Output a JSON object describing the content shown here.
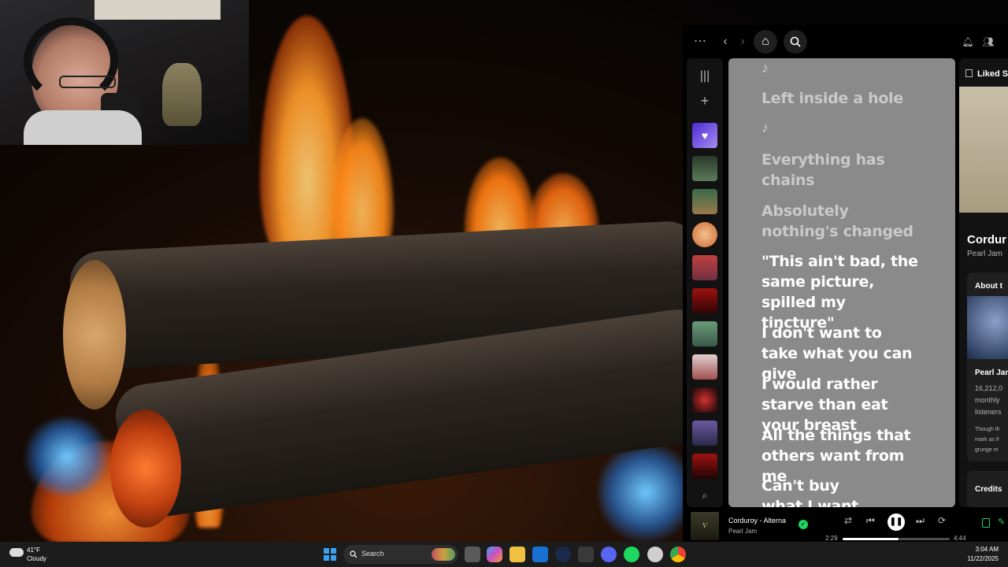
{
  "spotify": {
    "topbar": {
      "more_icon": "more-horizontal-icon",
      "back_icon": "chevron-left-icon",
      "forward_icon": "chevron-right-icon",
      "home_icon": "home-icon",
      "search_icon": "search-icon",
      "bell_icon": "bell-icon",
      "friends_icon": "friends-icon"
    },
    "lyrics": [
      {
        "text": "♪",
        "type": "note"
      },
      {
        "text": "Left inside a hole",
        "type": "line"
      },
      {
        "text": "♪",
        "type": "note"
      },
      {
        "text": "Everything has chains",
        "type": "line"
      },
      {
        "text": "Absolutely nothing's changed",
        "type": "line"
      },
      {
        "text": "\"This ain't bad, the same picture, spilled my tincture\"",
        "type": "active"
      },
      {
        "text": "I don't want to take what you can give",
        "type": "line"
      },
      {
        "text": "I would rather starve than eat your breast",
        "type": "line"
      },
      {
        "text": "All the things that others want from me",
        "type": "line"
      },
      {
        "text": "Can't buy what I want",
        "type": "line"
      }
    ],
    "right_panel": {
      "header": "Liked S",
      "song_title": "Cordur",
      "artist": "Pearl Jam",
      "about_label": "About t",
      "artist_short": "Pearl Jan",
      "listeners_line1": "16,212,0",
      "listeners_line2": "monthly",
      "listeners_line3": "listeners",
      "bio1": "Though th",
      "bio2": "mark as fr",
      "bio3": "grunge m",
      "credits": "Credits"
    },
    "player": {
      "track_title": "Corduroy - Alterna",
      "artist": "Pearl Jam",
      "elapsed": "2:29",
      "duration": "4:44",
      "progress": 0.52,
      "accent": "#1ed760"
    }
  },
  "taskbar": {
    "weather_temp": "41°F",
    "weather_desc": "Cloudy",
    "search_label": "Search",
    "time": "3:04 AM",
    "date": "11/22/2025"
  }
}
